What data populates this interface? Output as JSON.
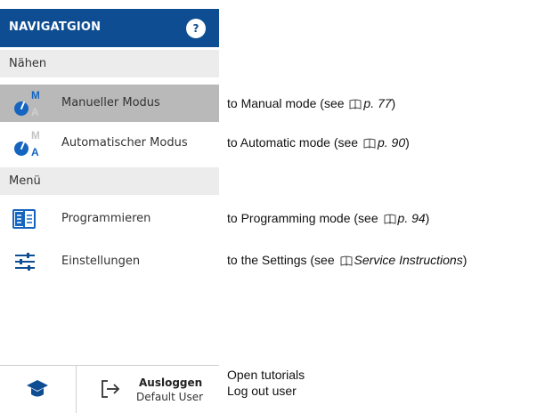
{
  "nav": {
    "title": "NAVIGATGION",
    "help_icon": "help-circle-icon",
    "help_label": "?",
    "sections": [
      {
        "label": "Nähen",
        "items": [
          {
            "label": "Manueller Modus",
            "icon": "manual-mode-icon",
            "active": true,
            "badge_top": "M",
            "badge_bottom": "A"
          },
          {
            "label": "Automatischer Modus",
            "icon": "automatic-mode-icon",
            "active": false,
            "badge_top": "M",
            "badge_bottom": "A"
          }
        ]
      },
      {
        "label": "Menü",
        "items": [
          {
            "label": "Programmieren",
            "icon": "programming-icon",
            "active": false
          },
          {
            "label": "Einstellungen",
            "icon": "settings-sliders-icon",
            "active": false
          }
        ]
      }
    ],
    "bottom": {
      "tutorial_icon": "graduation-cap-icon",
      "logout_icon": "logout-icon",
      "logout_label": "Ausloggen",
      "user_name": "Default User"
    }
  },
  "descriptions": {
    "manual": {
      "text": "to Manual mode (see ",
      "ref": "p. 77",
      "end": ")"
    },
    "automatic": {
      "text": "to Automatic mode (see ",
      "ref": "p. 90",
      "end": ")"
    },
    "programming": {
      "text": "to Programming mode (see ",
      "ref": "p. 94",
      "end": ")"
    },
    "settings": {
      "text": "to the Settings (see ",
      "ref": "Service Instructions",
      "end": ")"
    },
    "tutorials": "Open tutorials",
    "logout": "Log out user"
  },
  "colors": {
    "header_bg": "#0e4d92",
    "accent_blue": "#1565c0",
    "active_item_bg": "#b9b9b9",
    "section_bg": "#ececec"
  }
}
